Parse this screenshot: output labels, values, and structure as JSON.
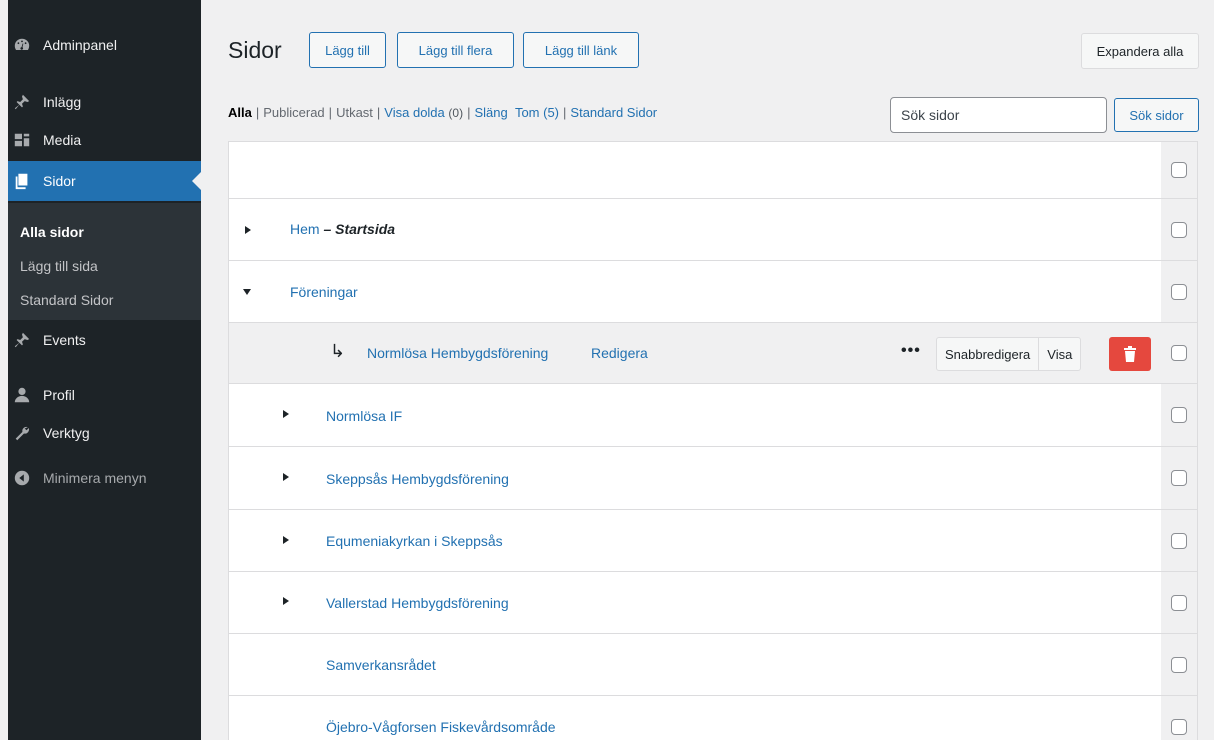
{
  "sidebar": {
    "items": [
      {
        "label": "Adminpanel",
        "icon": "dashboard-icon"
      },
      {
        "label": "Inlägg",
        "icon": "pin-icon"
      },
      {
        "label": "Media",
        "icon": "media-icon"
      },
      {
        "label": "Sidor",
        "icon": "pages-icon"
      },
      {
        "label": "Events",
        "icon": "pin-icon"
      },
      {
        "label": "Profil",
        "icon": "user-icon"
      },
      {
        "label": "Verktyg",
        "icon": "wrench-icon"
      }
    ],
    "submenu": [
      "Alla sidor",
      "Lägg till sida",
      "Standard Sidor"
    ],
    "collapse_label": "Minimera menyn"
  },
  "header": {
    "title": "Sidor",
    "add_new": "Lägg till",
    "add_multiple": "Lägg till flera",
    "add_link": "Lägg till länk",
    "expand_all": "Expandera alla"
  },
  "filters": {
    "all": "Alla",
    "published": "Publicerad",
    "draft": "Utkast",
    "hidden": "Visa dolda",
    "hidden_count": "(0)",
    "trash": "Släng",
    "empty": "Tom (5)",
    "standard": "Standard Sidor"
  },
  "search": {
    "placeholder": "Sök sidor",
    "button": "Sök sidor"
  },
  "rows": [
    {
      "title": "Hem",
      "dash": " – ",
      "state": "Startsida"
    },
    {
      "title": "Föreningar"
    },
    {
      "title": "Normlösa Hembygdsförening",
      "edit": "Redigera",
      "quick_edit": "Snabbredigera",
      "view": "Visa"
    },
    {
      "title": "Normlösa IF"
    },
    {
      "title": "Skeppsås Hembygdsförening"
    },
    {
      "title": "Equmeniakyrkan i Skeppsås"
    },
    {
      "title": "Vallerstad Hembygdsförening"
    },
    {
      "title": "Samverkansrådet"
    },
    {
      "title": "Öjebro-Vågforsen Fiskevårdsområde"
    }
  ],
  "colors": {
    "sidebar_bg": "#1d2327",
    "accent": "#2271b1",
    "delete": "#e5483e"
  }
}
